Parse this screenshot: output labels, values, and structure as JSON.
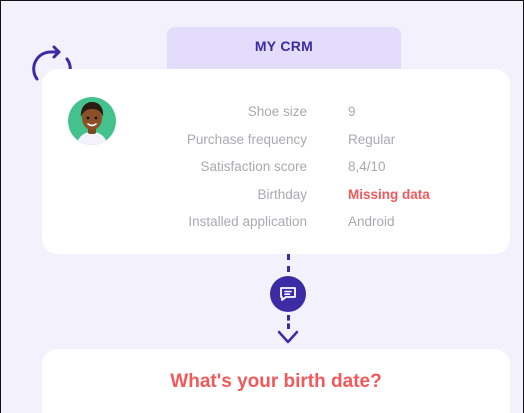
{
  "crm_tab": {
    "title": "MY CRM"
  },
  "profile": {
    "rows": [
      {
        "label": "Shoe size",
        "value": "9",
        "missing": false
      },
      {
        "label": "Purchase frequency",
        "value": "Regular",
        "missing": false
      },
      {
        "label": "Satisfaction score",
        "value": "8,4/10",
        "missing": false
      },
      {
        "label": "Birthday",
        "value": "Missing data",
        "missing": true
      },
      {
        "label": "Installed application",
        "value": "Android",
        "missing": false
      }
    ]
  },
  "question": {
    "text": "What's your birth date?"
  },
  "colors": {
    "background": "#f3f1fb",
    "tab": "#e4dcfb",
    "accent": "#3d2aa5",
    "missing": "#f2595a",
    "muted_text": "#a9a9b2",
    "avatar_bg": "#43c28d"
  },
  "icons": {
    "sync": "sync-icon",
    "avatar": "user-avatar",
    "message": "chat-message-icon",
    "arrow": "arrow-down-icon"
  }
}
